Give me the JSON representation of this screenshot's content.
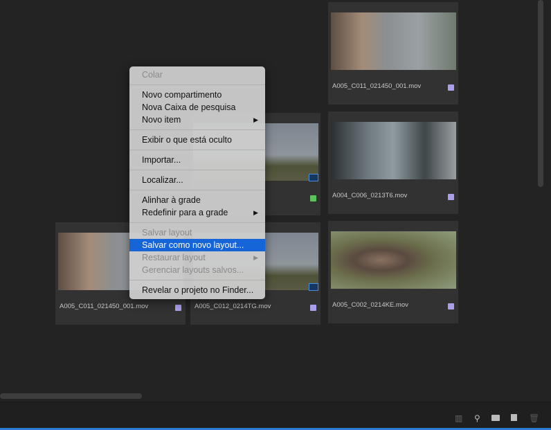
{
  "clips": [
    {
      "name": "A005_C011_021450_001.mov",
      "badge_color": "#a99ee8"
    },
    {
      "name": "",
      "badge_color": "#5cc25c"
    },
    {
      "name": "A004_C006_0213T6.mov",
      "badge_color": "#a99ee8"
    },
    {
      "name": "A005_C011_021450_001.mov",
      "badge_color": "#a99ee8"
    },
    {
      "name": "A005_C012_0214TG.mov",
      "badge_color": "#a99ee8"
    },
    {
      "name": "A005_C002_0214KE.mov",
      "badge_color": "#a99ee8"
    }
  ],
  "menu": {
    "colar": "Colar",
    "novo_compartimento": "Novo compartimento",
    "nova_caixa": "Nova Caixa de pesquisa",
    "novo_item": "Novo item",
    "exibir": "Exibir o que está oculto",
    "importar": "Importar...",
    "localizar": "Localizar...",
    "alinhar": "Alinhar à grade",
    "redefinir": "Redefinir para a grade",
    "salvar_layout": "Salvar layout",
    "salvar_novo": "Salvar como novo layout...",
    "restaurar": "Restaurar layout",
    "gerenciar": "Gerenciar layouts salvos...",
    "revelar": "Revelar o projeto no Finder...",
    "submenu_arrow": "▶"
  },
  "toolbar": {
    "icons": [
      "list-view-icon",
      "search-icon",
      "new-bin-icon",
      "new-item-icon",
      "trash-icon"
    ]
  }
}
